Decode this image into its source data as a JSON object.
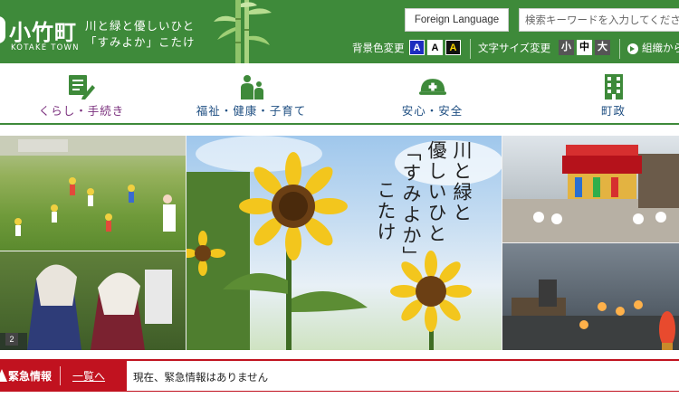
{
  "site": {
    "logo_jp": "小竹町",
    "logo_en": "KOTAKE TOWN",
    "slogan_line1": "川と緑と優しいひと",
    "slogan_line2": "「すみよか」こたけ"
  },
  "header": {
    "foreign_language_label": "Foreign Language",
    "search_placeholder": "検索キーワードを入力してください",
    "bg_color_label": "背景色変更",
    "bg_color_options": [
      "A",
      "A",
      "A"
    ],
    "font_size_label": "文字サイズ変更",
    "font_size_options": [
      "小",
      "中",
      "大"
    ],
    "org_link_label": "組織から"
  },
  "nav": {
    "items": [
      {
        "label": "くらし・手続き",
        "icon": "notebook-pen-icon"
      },
      {
        "label": "福祉・健康・子育て",
        "icon": "family-icon"
      },
      {
        "label": "安心・安全",
        "icon": "helmet-icon"
      },
      {
        "label": "町政",
        "icon": "building-icon"
      }
    ]
  },
  "hero": {
    "title_col1": "川と緑と",
    "title_col2": "優しいひと",
    "title_col3": "「すみよか」",
    "title_col4": "こたけ",
    "slide_number": "2"
  },
  "emergency": {
    "title": "緊急情報",
    "list_link": "一覧へ",
    "message": "現在、緊急情報はありません"
  },
  "colors": {
    "header_green": "#3e8a3a",
    "nav_text_blue": "#1f4f82",
    "nav_active_purple": "#7a2f7d",
    "emergency_red": "#c1121f"
  }
}
